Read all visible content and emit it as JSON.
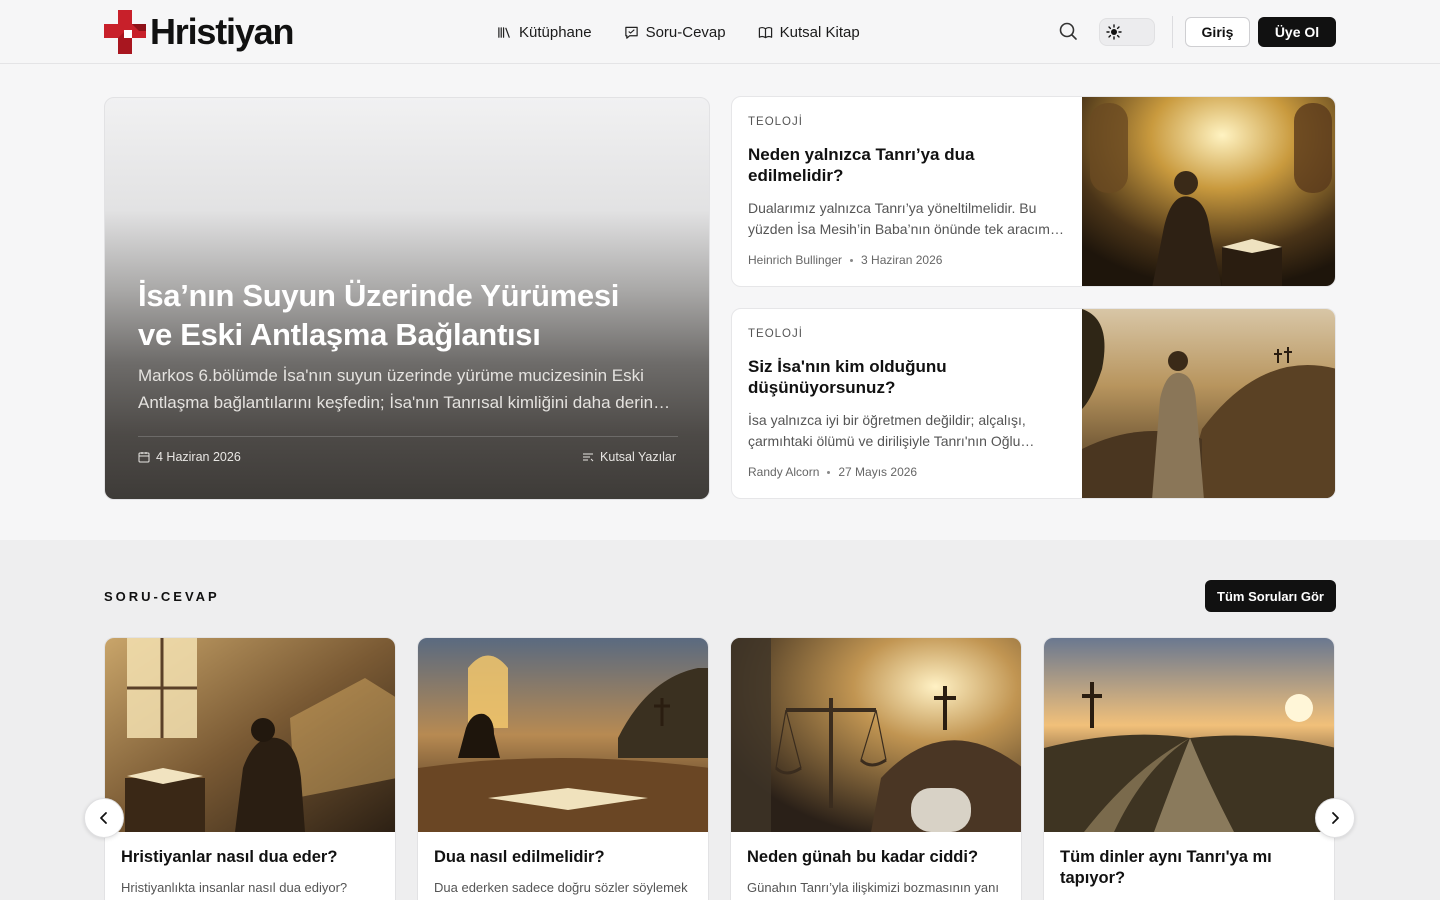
{
  "brand": {
    "name": "Hristiyan",
    "accent": "#c8202a"
  },
  "nav": [
    {
      "label": "Kütüphane",
      "icon": "library-icon"
    },
    {
      "label": "Soru-Cevap",
      "icon": "chat-icon"
    },
    {
      "label": "Kutsal Kitap",
      "icon": "book-icon"
    }
  ],
  "header": {
    "login_label": "Giriş",
    "signup_label": "Üye Ol"
  },
  "hero": {
    "title": "İsa’nın Suyun Üzerinde Yürümesi ve Eski Antlaşma Bağlantısı",
    "description": "Markos 6.bölümde İsa'nın suyun üzerinde yürüme mucizesinin Eski Antlaşma bağlantılarını keşfedin; İsa'nın Tanrısal kimliğini daha derin…",
    "date": "4 Haziran 2026",
    "category": "Kutsal Yazılar"
  },
  "side_articles": [
    {
      "category": "TEOLOJİ",
      "title": "Neden yalnızca Tanrı’ya dua edilmelidir?",
      "description": "Dualarımız yalnızca Tanrı’ya yöneltilmelidir. Bu yüzden İsa Mesih’in Baba’nın önünde tek aracım…",
      "author": "Heinrich Bullinger",
      "date": "3 Haziran 2026"
    },
    {
      "category": "TEOLOJİ",
      "title": "Siz İsa'nın kim olduğunu düşünüyorsunuz?",
      "description": "İsa yalnızca iyi bir öğretmen değildir; alçalışı, çarmıhtaki ölümü ve dirilişiyle Tanrı'nın Oğlu…",
      "author": "Randy Alcorn",
      "date": "27 Mayıs 2026"
    }
  ],
  "qa_section": {
    "title": "SORU-CEVAP",
    "button_label": "Tüm Soruları Gör",
    "cards": [
      {
        "title": "Hristiyanlar nasıl dua eder?",
        "description": "Hristiyanlıkta insanlar nasıl dua ediyor?"
      },
      {
        "title": "Dua nasıl edilmelidir?",
        "description": "Dua ederken sadece doğru sözler söylemek"
      },
      {
        "title": "Neden günah bu kadar ciddi?",
        "description": "Günahın Tanrı’yla ilişkimizi bozmasının yanı"
      },
      {
        "title": "Tüm dinler aynı Tanrı'ya mı tapıyor?",
        "description": ""
      }
    ]
  }
}
